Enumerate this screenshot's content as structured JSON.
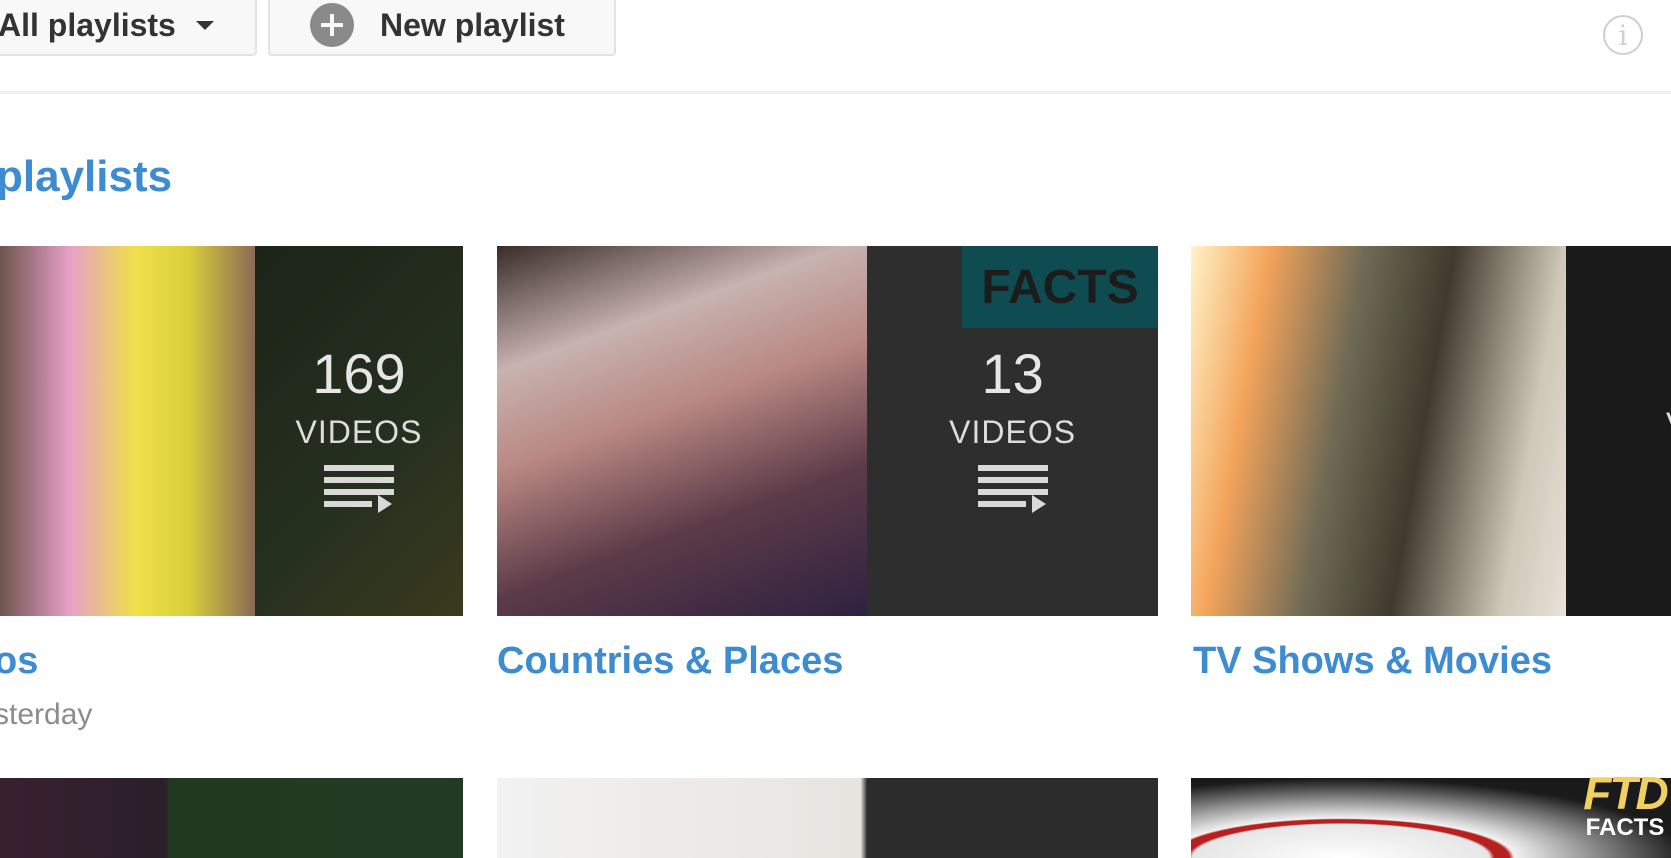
{
  "toolbar": {
    "all_playlists_label": "All playlists",
    "new_playlist_label": "New playlist"
  },
  "section": {
    "title": "playlists"
  },
  "cards": [
    {
      "count": "169",
      "count_label": "VIDEOS",
      "title": "os",
      "subtitle": "sterday"
    },
    {
      "count": "13",
      "count_label": "VIDEOS",
      "title": "Countries & Places",
      "badge": "FACTS"
    },
    {
      "count_label": "V",
      "title": "TV Shows & Movies"
    }
  ],
  "logo": {
    "top": "FTD",
    "bottom": "FACTS"
  },
  "colors": {
    "link": "#3d8bd1",
    "subtitle": "#8c8c8c",
    "logo": "#f0d060"
  }
}
